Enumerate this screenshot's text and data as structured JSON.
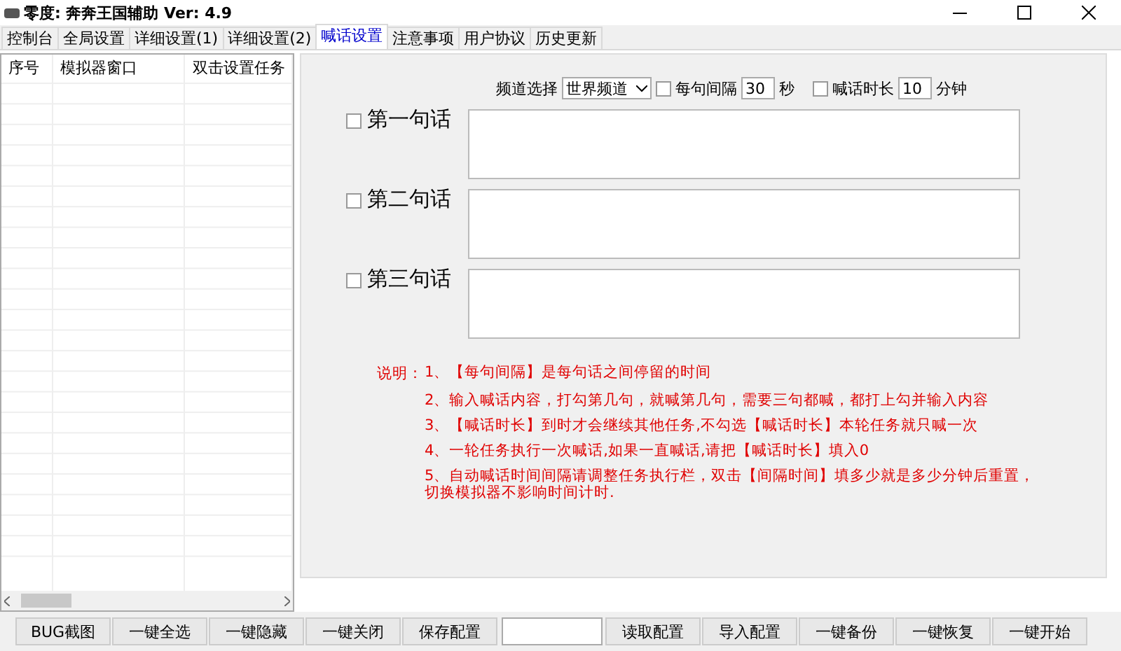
{
  "window": {
    "title": "零度: 奔奔王国辅助 Ver:  4.9"
  },
  "tabs": [
    {
      "label": "控制台",
      "selected": false
    },
    {
      "label": "全局设置",
      "selected": false
    },
    {
      "label": "详细设置(1)",
      "selected": false
    },
    {
      "label": "详细设置(2)",
      "selected": false
    },
    {
      "label": "喊话设置",
      "selected": true
    },
    {
      "label": "注意事项",
      "selected": false
    },
    {
      "label": "用户协议",
      "selected": false
    },
    {
      "label": "历史更新",
      "selected": false
    }
  ],
  "table": {
    "columns": [
      "序号",
      "模拟器窗口",
      "双击设置任务"
    ]
  },
  "settings": {
    "channel_label": "频道选择",
    "channel_value": "世界频道",
    "interval": {
      "label": "每句间隔",
      "checked": false,
      "value": "30",
      "unit": "秒"
    },
    "duration": {
      "label": "喊话时长",
      "checked": false,
      "value": "10",
      "unit": "分钟"
    }
  },
  "sentences": [
    {
      "label": "第一句话",
      "checked": false
    },
    {
      "label": "第二句话",
      "checked": false
    },
    {
      "label": "第三句话",
      "checked": false
    }
  ],
  "notes": {
    "title": "说明：",
    "items": [
      "1、【每句间隔】是每句话之间停留的时间",
      "2、输入喊话内容，打勾第几句，就喊第几句，需要三句都喊，都打上勾并输入内容",
      "3、【喊话时长】到时才会继续其他任务,不勾选【喊话时长】本轮任务就只喊一次",
      "4、一轮任务执行一次喊话,如果一直喊话,请把【喊话时长】填入0",
      "5、自动喊话时间间隔请调整任务执行栏，双击【间隔时间】填多少就是多少分钟后重置，",
      "切换模拟器不影响时间计时."
    ]
  },
  "buttons_left": [
    "BUG截图",
    "一键全选",
    "一键隐藏",
    "一键关闭",
    "保存配置"
  ],
  "buttons_right": [
    "读取配置",
    "导入配置",
    "一键备份",
    "一键恢复",
    "一键开始"
  ]
}
